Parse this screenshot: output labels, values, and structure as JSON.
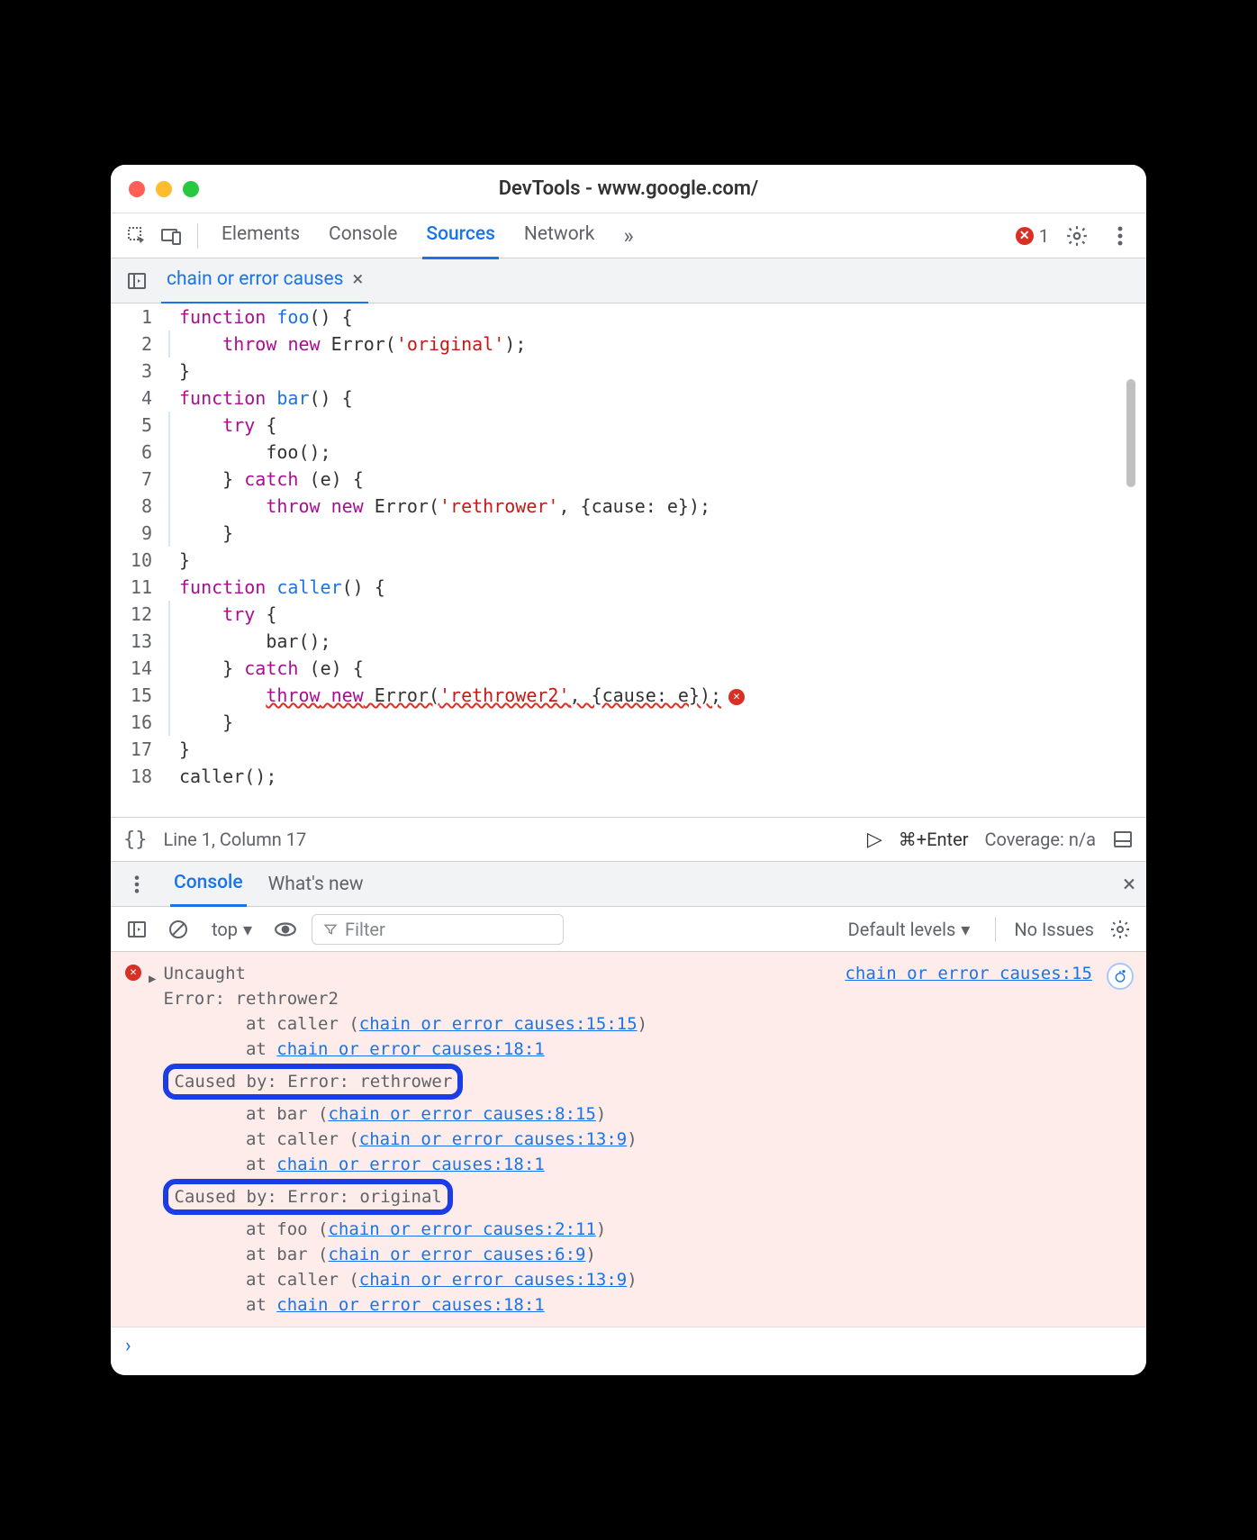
{
  "window_title": "DevTools - www.google.com/",
  "toolbar": {
    "tabs": [
      "Elements",
      "Console",
      "Sources",
      "Network"
    ],
    "active_tab": "Sources",
    "overflow_glyph": "»",
    "error_count": "1"
  },
  "file_tab": {
    "name": "chain or error causes",
    "close_glyph": "×"
  },
  "editor": {
    "gutter": [
      "1",
      "2",
      "3",
      "4",
      "5",
      "6",
      "7",
      "8",
      "9",
      "10",
      "11",
      "12",
      "13",
      "14",
      "15",
      "16",
      "17",
      "18"
    ],
    "lines": [
      {
        "indent": 0,
        "tokens": [
          {
            "t": "function",
            "c": "kw"
          },
          {
            "t": " "
          },
          {
            "t": "foo",
            "c": "fn"
          },
          {
            "t": "() {"
          }
        ]
      },
      {
        "indent": 1,
        "tokens": [
          {
            "t": "throw",
            "c": "kw"
          },
          {
            "t": " "
          },
          {
            "t": "new",
            "c": "kw"
          },
          {
            "t": " Error("
          },
          {
            "t": "'original'",
            "c": "str"
          },
          {
            "t": ");"
          }
        ]
      },
      {
        "indent": 0,
        "tokens": [
          {
            "t": "}"
          }
        ]
      },
      {
        "indent": 0,
        "tokens": [
          {
            "t": "function",
            "c": "kw"
          },
          {
            "t": " "
          },
          {
            "t": "bar",
            "c": "fn"
          },
          {
            "t": "() {"
          }
        ]
      },
      {
        "indent": 1,
        "tokens": [
          {
            "t": "try",
            "c": "kw"
          },
          {
            "t": " {"
          }
        ]
      },
      {
        "indent": 2,
        "tokens": [
          {
            "t": "foo();"
          }
        ]
      },
      {
        "indent": 1,
        "tokens": [
          {
            "t": "} "
          },
          {
            "t": "catch",
            "c": "kw"
          },
          {
            "t": " (e) {"
          }
        ]
      },
      {
        "indent": 2,
        "tokens": [
          {
            "t": "throw",
            "c": "kw"
          },
          {
            "t": " "
          },
          {
            "t": "new",
            "c": "kw"
          },
          {
            "t": " Error("
          },
          {
            "t": "'rethrower'",
            "c": "str"
          },
          {
            "t": ", {cause: e});"
          }
        ]
      },
      {
        "indent": 1,
        "tokens": [
          {
            "t": "}"
          }
        ]
      },
      {
        "indent": 0,
        "tokens": [
          {
            "t": "}"
          }
        ]
      },
      {
        "indent": 0,
        "tokens": [
          {
            "t": "function",
            "c": "kw"
          },
          {
            "t": " "
          },
          {
            "t": "caller",
            "c": "fn"
          },
          {
            "t": "() {"
          }
        ]
      },
      {
        "indent": 1,
        "tokens": [
          {
            "t": "try",
            "c": "kw"
          },
          {
            "t": " {"
          }
        ]
      },
      {
        "indent": 2,
        "tokens": [
          {
            "t": "bar();"
          }
        ]
      },
      {
        "indent": 1,
        "tokens": [
          {
            "t": "} "
          },
          {
            "t": "catch",
            "c": "kw"
          },
          {
            "t": " (e) {"
          }
        ]
      },
      {
        "indent": 2,
        "err": true,
        "tokens": [
          {
            "t": "throw",
            "c": "kw"
          },
          {
            "t": " "
          },
          {
            "t": "new",
            "c": "kw"
          },
          {
            "t": " Error("
          },
          {
            "t": "'rethrower2'",
            "c": "str"
          },
          {
            "t": ", {cause: e});"
          }
        ]
      },
      {
        "indent": 1,
        "tokens": [
          {
            "t": "}"
          }
        ]
      },
      {
        "indent": 0,
        "tokens": [
          {
            "t": "}"
          }
        ]
      },
      {
        "indent": 0,
        "tokens": [
          {
            "t": "caller();"
          }
        ]
      }
    ]
  },
  "statusbar": {
    "braces": "{}",
    "position": "Line 1, Column 17",
    "play_glyph": "▷",
    "shortcut": "⌘+Enter",
    "coverage": "Coverage: n/a"
  },
  "drawer": {
    "tabs": [
      "Console",
      "What's new"
    ],
    "active": "Console",
    "close_glyph": "×"
  },
  "console_toolbar": {
    "context": "top",
    "filter_placeholder": "Filter",
    "levels": "Default levels",
    "issues": "No Issues"
  },
  "console": {
    "source_link": "chain or error causes:15",
    "uncaught": "Uncaught",
    "lines": [
      {
        "indent": 0,
        "text": "Error: rethrower2"
      },
      {
        "indent": 2,
        "text": "at caller (",
        "link": "chain or error causes:15:15",
        "after": ")"
      },
      {
        "indent": 2,
        "text": "at ",
        "link": "chain or error causes:18:1"
      },
      {
        "boxed": true,
        "text": "Caused by: Error: rethrower"
      },
      {
        "indent": 2,
        "text": "at bar (",
        "link": "chain or error causes:8:15",
        "after": ")"
      },
      {
        "indent": 2,
        "text": "at caller (",
        "link": "chain or error causes:13:9",
        "after": ")"
      },
      {
        "indent": 2,
        "text": "at ",
        "link": "chain or error causes:18:1"
      },
      {
        "boxed": true,
        "text": "Caused by: Error: original"
      },
      {
        "indent": 2,
        "text": "at foo (",
        "link": "chain or error causes:2:11",
        "after": ")"
      },
      {
        "indent": 2,
        "text": "at bar (",
        "link": "chain or error causes:6:9",
        "after": ")"
      },
      {
        "indent": 2,
        "text": "at caller (",
        "link": "chain or error causes:13:9",
        "after": ")"
      },
      {
        "indent": 2,
        "text": "at ",
        "link": "chain or error causes:18:1"
      }
    ],
    "prompt_glyph": "›"
  }
}
